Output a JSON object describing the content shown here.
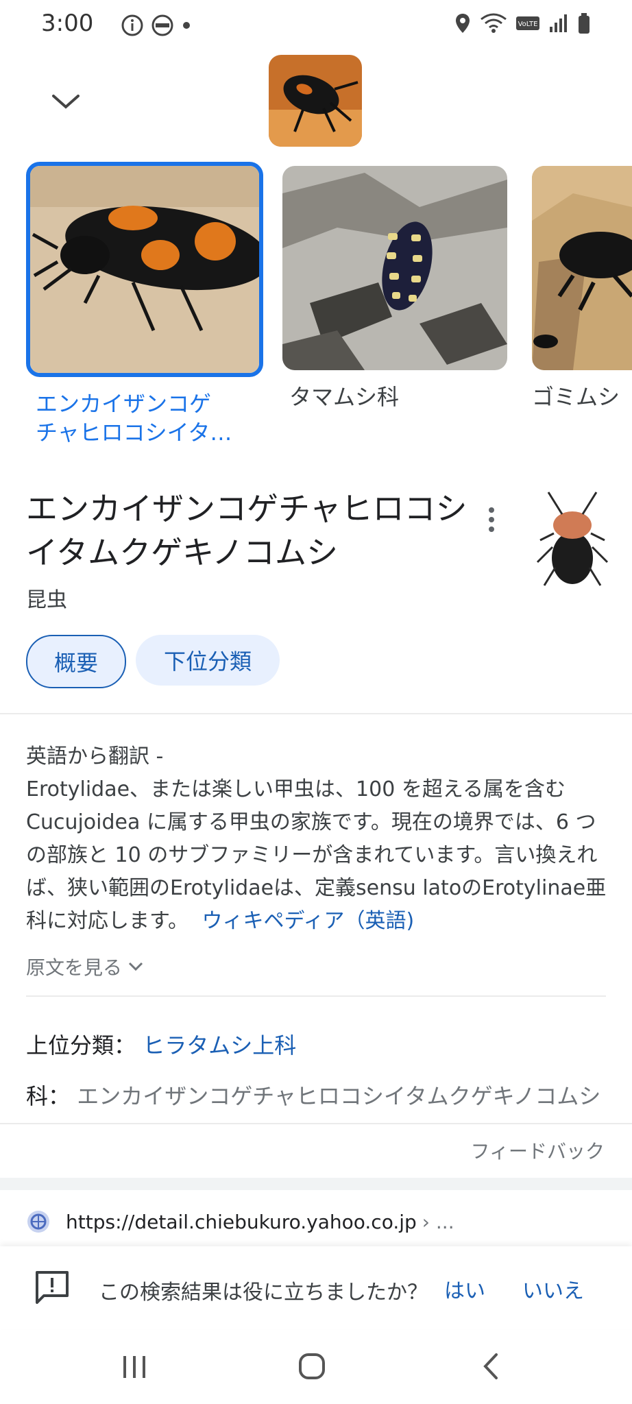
{
  "status_bar": {
    "time": "3:00"
  },
  "carousel": {
    "items": [
      {
        "label": "エンカイザンコゲ\nチャヒロコシイタ…",
        "selected": true
      },
      {
        "label": "タマムシ科",
        "selected": false
      },
      {
        "label": "ゴミムシ",
        "selected": false
      }
    ]
  },
  "entity": {
    "title": "エンカイザンコゲチャヒロコシイタムクゲキノコムシ",
    "subtitle": "昆虫",
    "tabs": [
      "概要",
      "下位分類"
    ],
    "description": {
      "prefix": "英語から翻訳 -",
      "body": "Erotylidae、または楽しい甲虫は、100 を超える属を含む Cucujoidea に属する甲虫の家族です。現在の境界では、6 つの部族と 10 のサブファミリーが含まれています。言い換えれば、狭い範囲のErotylidaeは、定義sensu latoのErotylinae亜科に対応します。",
      "source_link": "ウィキペディア（英語)"
    },
    "see_original": "原文を見る",
    "facts": [
      {
        "key": "上位分類",
        "value": "ヒラタムシ上科",
        "link": true
      },
      {
        "key": "科",
        "value": "エンカイザンコゲチャヒロコシイタムクゲキノコムシ",
        "link": false
      }
    ],
    "feedback": "フィードバック"
  },
  "result": {
    "url": "https://detail.chiebukuro.yahoo.co.jp",
    "url_suffix": "› ..."
  },
  "survey": {
    "question": "この検索結果は役に立ちましたか？",
    "yes": "はい",
    "no": "いいえ"
  },
  "colors": {
    "accent": "#1a73e8",
    "link": "#1a5fb4",
    "chip_bg": "#e8f0fe"
  }
}
